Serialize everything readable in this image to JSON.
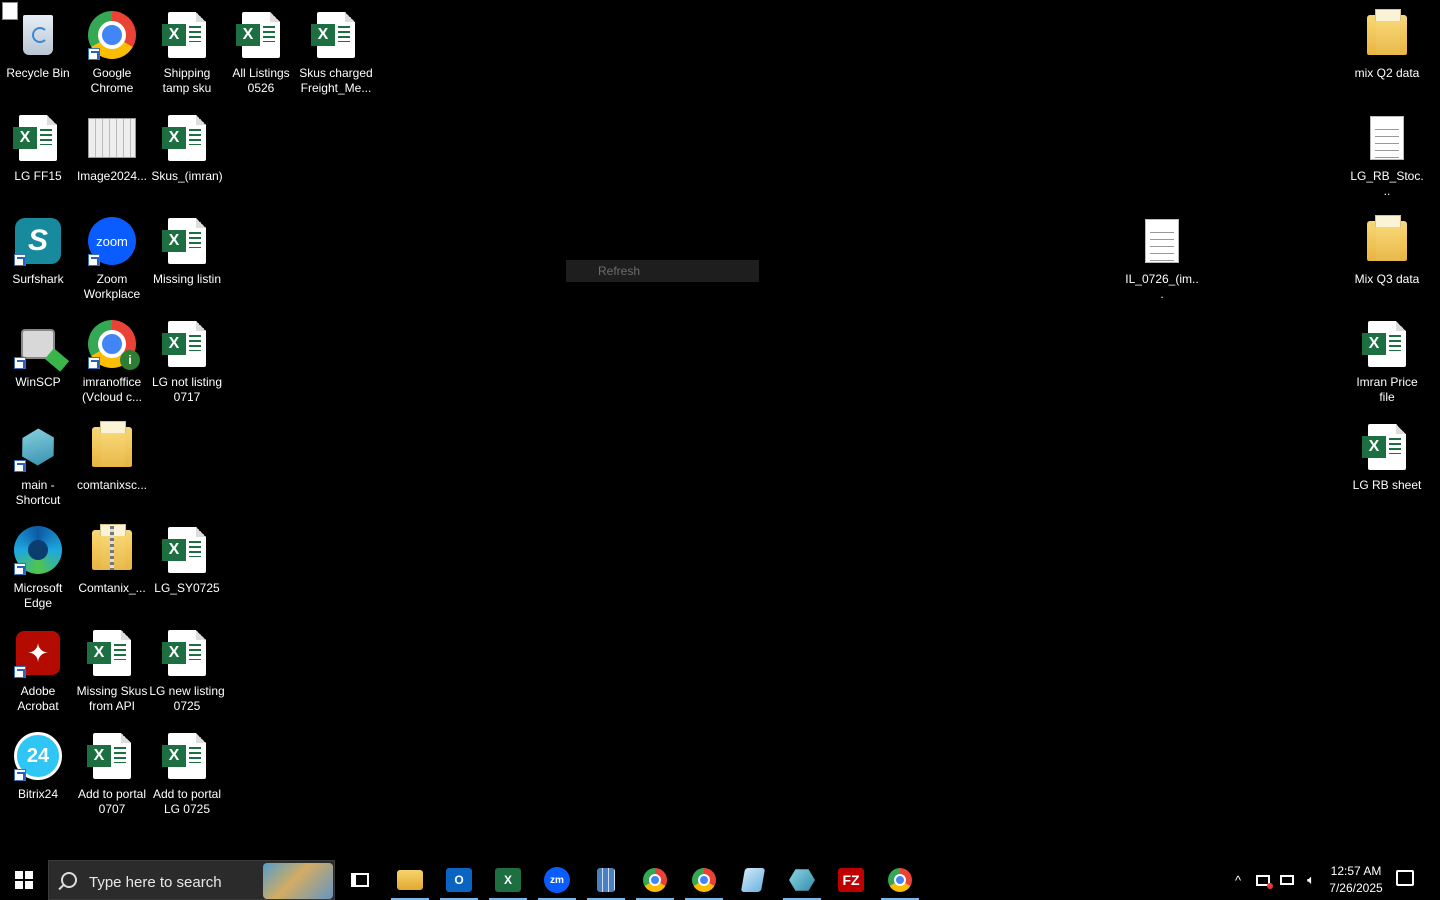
{
  "desktop": {
    "context_menu_item": "Refresh",
    "icons": [
      {
        "label": "Recycle Bin",
        "icon": "recycle-bin-icon"
      },
      {
        "label": "Google Chrome",
        "icon": "chrome-icon"
      },
      {
        "label": "Shipping tamp sku",
        "icon": "excel-file-icon"
      },
      {
        "label": "All Listings 0526",
        "icon": "excel-file-icon"
      },
      {
        "label": "Skus charged Freight_Me...",
        "icon": "excel-file-icon"
      },
      {
        "label": "mix Q2 data",
        "icon": "folder-icon"
      },
      {
        "label": "LG FF15",
        "icon": "excel-file-icon"
      },
      {
        "label": "Image2024...",
        "icon": "image-file-icon"
      },
      {
        "label": "Skus_(imran)",
        "icon": "excel-file-icon"
      },
      {
        "label": "LG_RB_Stoc...",
        "icon": "text-file-icon"
      },
      {
        "label": "Surfshark",
        "icon": "surfshark-icon"
      },
      {
        "label": "Zoom Workplace",
        "icon": "zoom-icon"
      },
      {
        "label": "Missing listin",
        "icon": "excel-file-icon"
      },
      {
        "label": "IL_0726_(im...",
        "icon": "text-file-icon"
      },
      {
        "label": "Mix Q3 data",
        "icon": "folder-icon"
      },
      {
        "label": "WinSCP",
        "icon": "winscp-icon"
      },
      {
        "label": "imranoffice (Vcloud c...",
        "icon": "chrome-profile-icon"
      },
      {
        "label": "LG not listing 0717",
        "icon": "excel-file-icon"
      },
      {
        "label": "Imran Price file",
        "icon": "excel-file-icon"
      },
      {
        "label": "main - Shortcut",
        "icon": "app-shortcut-icon"
      },
      {
        "label": "comtanixsc...",
        "icon": "folder-icon"
      },
      {
        "label": "LG RB sheet",
        "icon": "excel-file-icon"
      },
      {
        "label": "Microsoft Edge",
        "icon": "edge-icon"
      },
      {
        "label": "Comtanix_...",
        "icon": "zip-folder-icon"
      },
      {
        "label": "LG_SY0725",
        "icon": "excel-file-icon"
      },
      {
        "label": "Adobe Acrobat",
        "icon": "acrobat-icon"
      },
      {
        "label": "Missing Skus from API",
        "icon": "excel-file-icon"
      },
      {
        "label": "LG new listing 0725",
        "icon": "excel-file-icon"
      },
      {
        "label": "Bitrix24",
        "icon": "bitrix24-icon"
      },
      {
        "label": "Add to portal 0707",
        "icon": "excel-file-icon"
      },
      {
        "label": "Add to portal LG 0725",
        "icon": "excel-file-icon"
      }
    ]
  },
  "taskbar": {
    "search_placeholder": "Type here to search",
    "pinned": [
      "task-view-icon",
      "file-explorer-icon",
      "outlook-icon",
      "excel-icon",
      "zoom-icon",
      "calculator-icon",
      "chrome-icon",
      "chrome-profile-icon",
      "notepad-icon",
      "app-icon",
      "filezilla-icon",
      "chrome-profile2-icon"
    ],
    "clock_time": "12:57 AM",
    "clock_date": "7/26/2025"
  },
  "colors": {
    "excel": "#1d6f42",
    "accent": "#76b9ed",
    "desktop": "#000000"
  }
}
